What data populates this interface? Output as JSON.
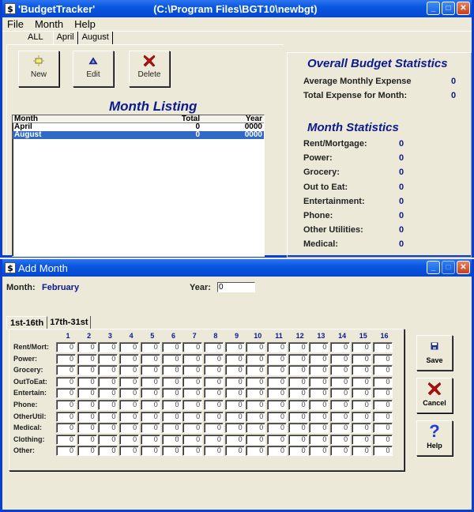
{
  "main_window": {
    "title_app": "'BudgetTracker'",
    "title_path": "(C:\\Program Files\\BGT10\\newbgt)",
    "app_icon": "dollar-icon",
    "controls": [
      "minimize",
      "maximize",
      "close"
    ],
    "menu": [
      "File",
      "Month",
      "Help"
    ],
    "tabs": [
      {
        "label": "ALL",
        "active": true
      },
      {
        "label": "April",
        "active": false
      },
      {
        "label": "August",
        "active": false
      }
    ],
    "toolbar": {
      "new_label": "New",
      "edit_label": "Edit",
      "delete_label": "Delete"
    },
    "month_listing": {
      "title": "Month Listing",
      "columns": [
        "Month",
        "Total",
        "Year"
      ],
      "rows": [
        {
          "month": "April",
          "total": "0",
          "year": "0000",
          "selected": false
        },
        {
          "month": "August",
          "total": "0",
          "year": "0000",
          "selected": true
        }
      ]
    },
    "overall_stats": {
      "title": "Overall Budget Statistics",
      "items": [
        {
          "label": "Average Monthly Expense",
          "value": "0"
        },
        {
          "label": "Total Expense for Month:",
          "value": "0"
        }
      ]
    },
    "month_stats": {
      "title": "Month Statistics",
      "items": [
        {
          "label": "Rent/Mortgage:",
          "value": "0"
        },
        {
          "label": "Power:",
          "value": "0"
        },
        {
          "label": "Grocery:",
          "value": "0"
        },
        {
          "label": "Out to Eat:",
          "value": "0"
        },
        {
          "label": "Entertainment:",
          "value": "0"
        },
        {
          "label": "Phone:",
          "value": "0"
        },
        {
          "label": "Other Utilities:",
          "value": "0"
        },
        {
          "label": "Medical:",
          "value": "0"
        }
      ]
    }
  },
  "add_month": {
    "title": "Add Month",
    "month_label": "Month:",
    "month_value": "February",
    "year_label": "Year:",
    "year_value": "0",
    "tabs": [
      {
        "label": "1st-16th",
        "active": true
      },
      {
        "label": "17th-31st",
        "active": false
      }
    ],
    "columns": [
      "1",
      "2",
      "3",
      "4",
      "5",
      "6",
      "7",
      "8",
      "9",
      "10",
      "11",
      "12",
      "13",
      "14",
      "15",
      "16"
    ],
    "rows": [
      {
        "label": "Rent/Mort:",
        "values": [
          "0",
          "0",
          "0",
          "0",
          "0",
          "0",
          "0",
          "0",
          "0",
          "0",
          "0",
          "0",
          "0",
          "0",
          "0",
          "0"
        ]
      },
      {
        "label": "Power:",
        "values": [
          "0",
          "0",
          "0",
          "0",
          "0",
          "0",
          "0",
          "0",
          "0",
          "0",
          "0",
          "0",
          "0",
          "0",
          "0",
          "0"
        ]
      },
      {
        "label": "Grocery:",
        "values": [
          "0",
          "0",
          "0",
          "0",
          "0",
          "0",
          "0",
          "0",
          "0",
          "0",
          "0",
          "0",
          "0",
          "0",
          "0",
          "0"
        ]
      },
      {
        "label": "OutToEat:",
        "values": [
          "0",
          "0",
          "0",
          "0",
          "0",
          "0",
          "0",
          "0",
          "0",
          "0",
          "0",
          "0",
          "0",
          "0",
          "0",
          "0"
        ]
      },
      {
        "label": "Entertain:",
        "values": [
          "0",
          "0",
          "0",
          "0",
          "0",
          "0",
          "0",
          "0",
          "0",
          "0",
          "0",
          "0",
          "0",
          "0",
          "0",
          "0"
        ]
      },
      {
        "label": "Phone:",
        "values": [
          "0",
          "0",
          "0",
          "0",
          "0",
          "0",
          "0",
          "0",
          "0",
          "0",
          "0",
          "0",
          "0",
          "0",
          "0",
          "0"
        ]
      },
      {
        "label": "OtherUtil:",
        "values": [
          "0",
          "0",
          "0",
          "0",
          "0",
          "0",
          "0",
          "0",
          "0",
          "0",
          "0",
          "0",
          "0",
          "0",
          "0",
          "0"
        ]
      },
      {
        "label": "Medical:",
        "values": [
          "0",
          "0",
          "0",
          "0",
          "0",
          "0",
          "0",
          "0",
          "0",
          "0",
          "0",
          "0",
          "0",
          "0",
          "0",
          "0"
        ]
      },
      {
        "label": "Clothing:",
        "values": [
          "0",
          "0",
          "0",
          "0",
          "0",
          "0",
          "0",
          "0",
          "0",
          "0",
          "0",
          "0",
          "0",
          "0",
          "0",
          "0"
        ]
      },
      {
        "label": "Other:",
        "values": [
          "0",
          "0",
          "0",
          "0",
          "0",
          "0",
          "0",
          "0",
          "0",
          "0",
          "0",
          "0",
          "0",
          "0",
          "0",
          "0"
        ]
      }
    ],
    "buttons": {
      "save_label": "Save",
      "cancel_label": "Cancel",
      "help_label": "Help"
    }
  }
}
